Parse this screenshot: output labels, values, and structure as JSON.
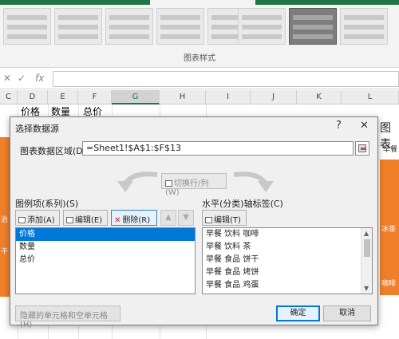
{
  "ribbon": {
    "group_label": "图表样式"
  },
  "formula_bar": {
    "cancel_glyph": "✕",
    "confirm_glyph": "✓",
    "fx_label": "fx",
    "value": ""
  },
  "sheet": {
    "columns": [
      "C",
      "D",
      "E",
      "F",
      "G",
      "H",
      "I",
      "J",
      "K",
      "L"
    ],
    "active_column": "G",
    "header_row": [
      "价格",
      "数量",
      "总价"
    ],
    "left_fragments": [
      "治",
      "干"
    ],
    "right_fragments": [
      "图表",
      "早餐",
      "冰茶",
      "咖啡"
    ]
  },
  "dialog": {
    "title": "选择数据源",
    "help": "?",
    "close": "✕",
    "range_label": "图表数据区域(D):",
    "range_value": "=Sheet1!$A$1:$F$13",
    "switch_label": "切换行/列(W)",
    "legend_label": "图例项(系列)(S)",
    "legend_buttons": {
      "add": "添加(A)",
      "edit": "编辑(E)",
      "delete": "删除(R)",
      "up": "▲",
      "down": "▼"
    },
    "series": [
      "价格",
      "数量",
      "总价"
    ],
    "selected_series": 0,
    "axis_label": "水平(分类)轴标签(C)",
    "axis_edit": "编辑(T)",
    "categories": [
      "早餐 饮料 咖啡",
      "早餐 饮料 茶",
      "早餐 食品 饼干",
      "早餐 食品 烤饼",
      "早餐 食品 鸡蛋"
    ],
    "hidden_cells_button": "隐藏的单元格和空单元格(H)",
    "ok": "确定",
    "cancel": "取消"
  },
  "colors": {
    "accent": "#217346",
    "chart_orange": "#f07f2a",
    "selection": "#0078d7"
  }
}
